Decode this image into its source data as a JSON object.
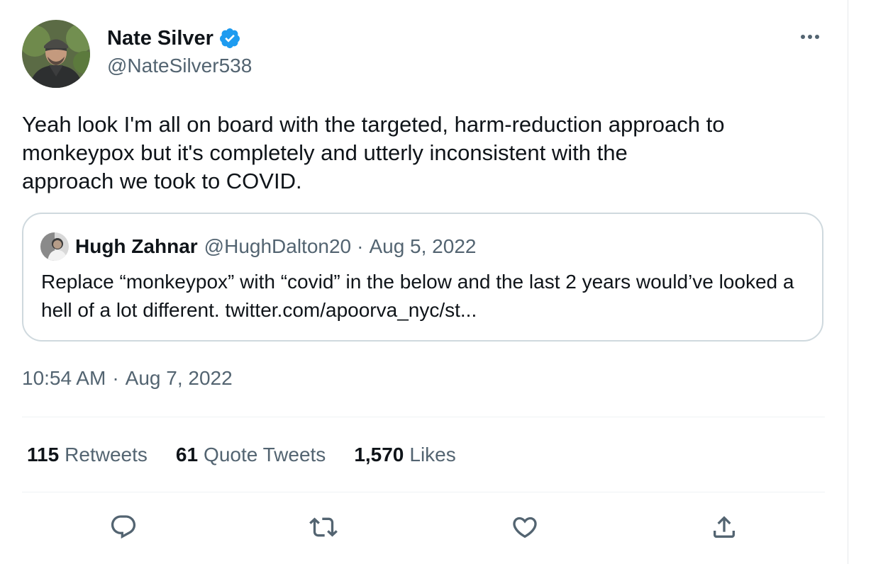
{
  "author": {
    "name": "Nate Silver",
    "handle": "@NateSilver538",
    "verified": true
  },
  "tweet": {
    "text": "Yeah look I'm all on board with the targeted, harm-reduction approach to\nmonkeypox but it's completely and utterly inconsistent with the\napproach we took to COVID.",
    "time": "10:54 AM",
    "separator": "·",
    "date": "Aug 7, 2022"
  },
  "quoted": {
    "name": "Hugh Zahnar",
    "handle": "@HughDalton20",
    "separator": "·",
    "date": "Aug 5, 2022",
    "text": "Replace “monkeypox” with “covid” in the below and the last 2 years would’ve looked a hell of a lot different. twitter.com/apoorva_nyc/st..."
  },
  "stats": {
    "retweets": {
      "count": "115",
      "label": "Retweets"
    },
    "quotes": {
      "count": "61",
      "label": "Quote Tweets"
    },
    "likes": {
      "count": "1,570",
      "label": "Likes"
    }
  },
  "icons": {
    "more": "more-horizontal-icon",
    "verified": "verified-badge-icon",
    "reply": "reply-icon",
    "retweet": "retweet-icon",
    "like": "heart-icon",
    "share": "share-icon"
  },
  "colors": {
    "text": "#0f1419",
    "secondary": "#536471",
    "verified": "#1d9bf0",
    "border": "#cfd9de"
  }
}
